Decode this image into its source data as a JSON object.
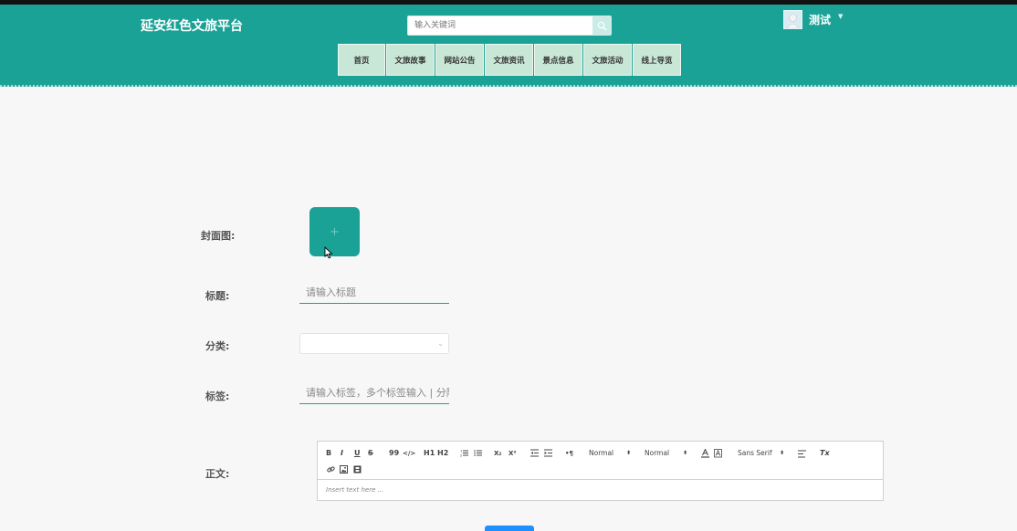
{
  "header": {
    "site_title": "延安红色文旅平台",
    "search_placeholder": "输入关键词",
    "user_name": "测试"
  },
  "nav": {
    "items": [
      {
        "label": "首页"
      },
      {
        "label": "文旅故事"
      },
      {
        "label": "网站公告"
      },
      {
        "label": "文旅资讯"
      },
      {
        "label": "景点信息"
      },
      {
        "label": "文旅活动"
      },
      {
        "label": "线上导览"
      }
    ]
  },
  "form": {
    "cover_label": "封面图:",
    "cover_plus": "+",
    "title_label": "标题:",
    "title_placeholder": "请输入标题",
    "category_label": "分类:",
    "tags_label": "标签:",
    "tags_placeholder": "请输入标签，多个标签输入 | 分隔",
    "body_label": "正文:"
  },
  "editor": {
    "toolbar": {
      "bold": "B",
      "italic": "I",
      "underline": "U",
      "strike": "S",
      "blockquote": "99",
      "code": "</>",
      "h1": "H1",
      "h2": "H2",
      "subscript": "X₂",
      "superscript": "X²",
      "direction": "•¶",
      "size_value": "Normal",
      "header_value": "Normal",
      "font_value": "Sans Serif",
      "clean": "Tx"
    },
    "placeholder": "Insert text here ..."
  },
  "colors": {
    "header_bg": "#1ba297",
    "nav_bg": "#c9e7d6",
    "submit_bg": "#1e90ff"
  }
}
